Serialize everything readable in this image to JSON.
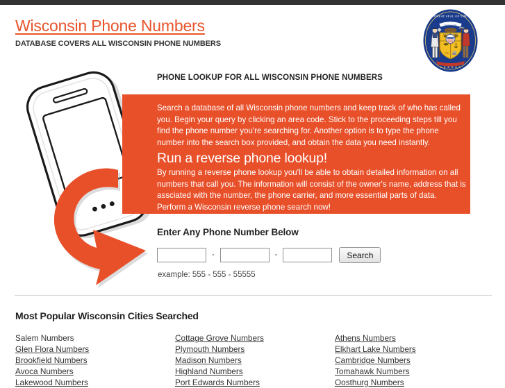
{
  "header": {
    "title": "Wisconsin Phone Numbers",
    "tagline": "DATABASE COVERS ALL WISCONSIN PHONE NUMBERS",
    "seal_alt": "Great Seal of the State of Wisconsin",
    "seal_ring_text_top": "GREAT SEAL OF THE STATE OF WISCONSIN",
    "seal_banner_text": "FORWARD",
    "seal_motto": "E PLURIBUS UNUM"
  },
  "hero": {
    "lookup_heading": "PHONE LOOKUP FOR ALL WISCONSIN PHONE NUMBERS",
    "paragraph_1": "Search a database of all Wisconsin phone numbers and keep track of who has called you. Begin your query by clicking an area code. Stick to the proceeding steps till you find the phone number you're searching for. Another option is to type the phone number into the search box provided, and obtain the data you need instantly.",
    "subheading": "Run a reverse phone lookup!",
    "paragraph_2": "By running a reverse phone lookup you'll be able to obtain detailed information on all numbers that call you. The information will consist of the owner's name, address that is assciated with the number, the phone carrier, and more essential parts of data. Perform a Wisconsin reverse phone search now!"
  },
  "search": {
    "heading": "Enter Any Phone Number Below",
    "area_code_value": "",
    "prefix_value": "",
    "line_value": "",
    "separator": "-",
    "button_label": "Search",
    "example": "example: 555 - 555 - 55555"
  },
  "cities": {
    "heading": "Most Popular Wisconsin Cities Searched",
    "columns": [
      [
        {
          "label": "Salem Numbers",
          "underlined": false
        },
        {
          "label": "Glen Flora Numbers",
          "underlined": true
        },
        {
          "label": "Brookfield Numbers",
          "underlined": true
        },
        {
          "label": "Avoca Numbers",
          "underlined": true
        },
        {
          "label": "Lakewood Numbers",
          "underlined": true
        }
      ],
      [
        {
          "label": "Cottage Grove Numbers",
          "underlined": true
        },
        {
          "label": "Plymouth Numbers",
          "underlined": true
        },
        {
          "label": "Madison Numbers",
          "underlined": true
        },
        {
          "label": "Highland Numbers",
          "underlined": true
        },
        {
          "label": "Port Edwards Numbers",
          "underlined": true
        }
      ],
      [
        {
          "label": "Athens Numbers",
          "underlined": true
        },
        {
          "label": "Elkhart Lake Numbers",
          "underlined": true
        },
        {
          "label": "Cambridge Numbers",
          "underlined": true
        },
        {
          "label": "Tomahawk Numbers",
          "underlined": true
        },
        {
          "label": "Oosthurg Numbers",
          "underlined": true
        }
      ]
    ]
  },
  "colors": {
    "accent_orange": "#E8502A",
    "topbar_dark": "#333333",
    "text_dark": "#222222",
    "divider_gray": "#d4d4d4",
    "seal_blue": "#1B3C8C",
    "seal_gold": "#F2BE22"
  }
}
